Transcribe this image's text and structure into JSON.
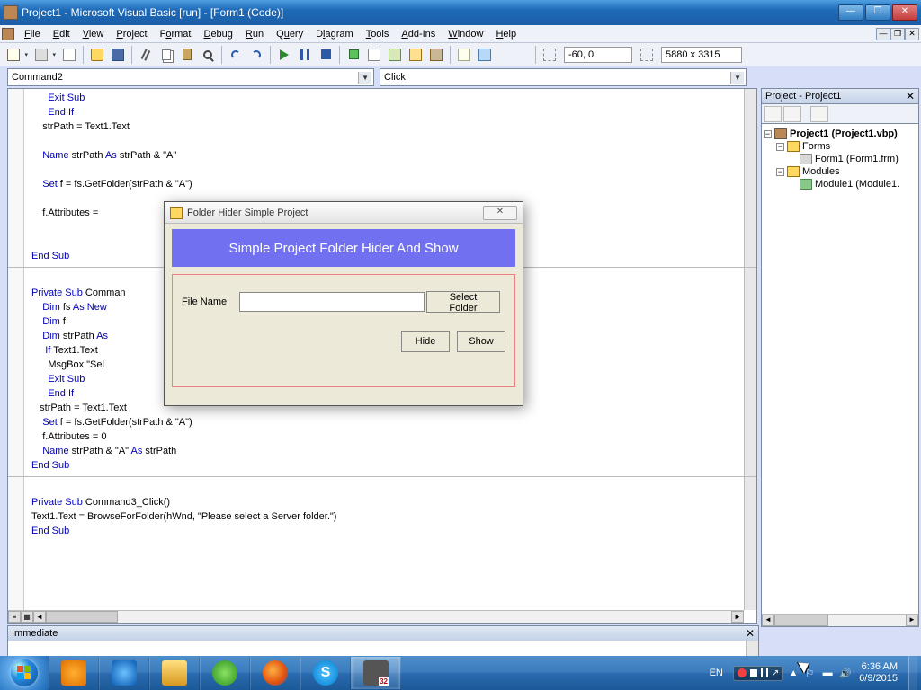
{
  "window": {
    "title": "Project1 - Microsoft Visual Basic [run] - [Form1 (Code)]"
  },
  "menus": [
    "File",
    "Edit",
    "View",
    "Project",
    "Format",
    "Debug",
    "Run",
    "Query",
    "Diagram",
    "Tools",
    "Add-Ins",
    "Window",
    "Help"
  ],
  "status_coords": "-60, 0",
  "status_size": "5880 x 3315",
  "combo_object": "Command2",
  "combo_proc": "Click",
  "project_panel": {
    "title": "Project - Project1",
    "root": "Project1 (Project1.vbp)",
    "forms_folder": "Forms",
    "form_item": "Form1 (Form1.frm)",
    "modules_folder": "Modules",
    "module_item": "Module1 (Module1."
  },
  "immediate_title": "Immediate",
  "dialog": {
    "title": "Folder Hider Simple Project",
    "banner": "Simple Project Folder Hider And Show",
    "file_label": "File Name",
    "select_btn": "Select Folder",
    "hide_btn": "Hide",
    "show_btn": "Show"
  },
  "taskbar": {
    "lang": "EN",
    "time": "6:36 AM",
    "date": "6/9/2015"
  },
  "code": {
    "l1a": "Exit Sub",
    "l1b": "",
    "l2a": "End If",
    "l2b": "",
    "l3": "    strPath = Text1.Text",
    "l4": "",
    "l5a": "    ",
    "l5b": "Name",
    "l5c": " strPath ",
    "l5d": "As",
    "l5e": " strPath & \"A\"",
    "l6": "",
    "l7a": "    ",
    "l7b": "Set",
    "l7c": " f = fs.GetFolder(strPath & \"A\")",
    "l8": "",
    "l9": "    f.Attributes =",
    "l10": "",
    "l11": "",
    "l12a": "End Sub",
    "l13": "",
    "l14a": "Private Sub",
    "l14b": " Comman",
    "l15a": "    ",
    "l15b": "Dim",
    "l15c": " fs ",
    "l15d": "As New",
    "l16a": "    ",
    "l16b": "Dim",
    "l16c": " f",
    "l17a": "    ",
    "l17b": "Dim",
    "l17c": " strPath ",
    "l17d": "As",
    "l18a": "     ",
    "l18b": "If",
    "l18c": " Text1.Text",
    "l19": "      MsgBox \"Sel",
    "l20a": "      ",
    "l20b": "Exit Sub",
    "l21a": "      ",
    "l21b": "End If",
    "l22": "   strPath = Text1.Text",
    "l23a": "    ",
    "l23b": "Set",
    "l23c": " f = fs.GetFolder(strPath & \"A\")",
    "l24": "    f.Attributes = 0",
    "l25a": "    ",
    "l25b": "Name",
    "l25c": " strPath & \"A\" ",
    "l25d": "As",
    "l25e": " strPath",
    "l26a": "End Sub",
    "l27": "",
    "l28a": "Private Sub",
    "l28b": " Command3_Click()",
    "l29": "Text1.Text = BrowseForFolder(hWnd, \"Please select a Server folder.\")",
    "l30a": "End Sub"
  }
}
